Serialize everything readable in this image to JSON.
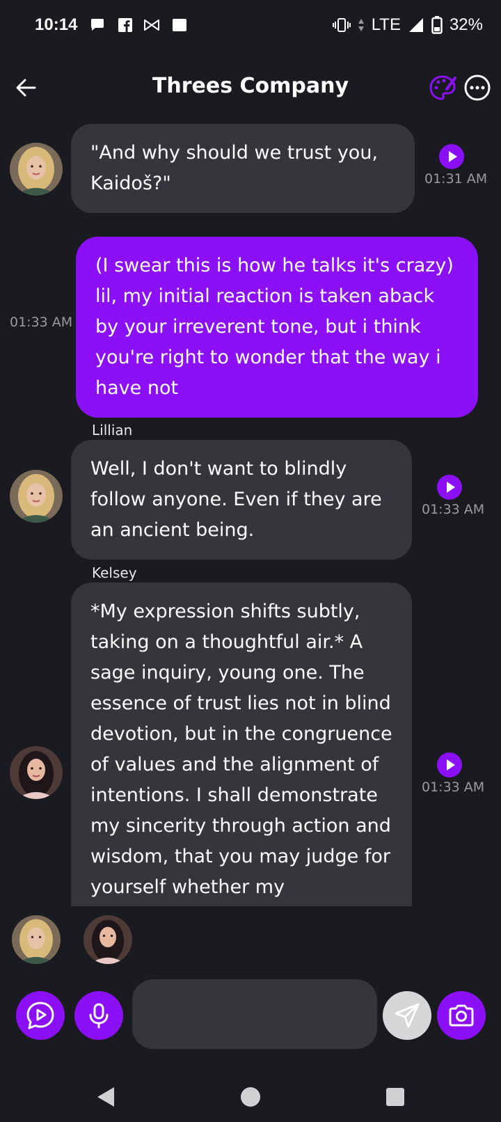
{
  "status": {
    "time": "10:14",
    "network": "LTE",
    "battery": "32%"
  },
  "header": {
    "title": "Threes Company"
  },
  "messages": [
    {
      "sender": "",
      "text": "\"And why should we trust you, Kaidoš?\"",
      "time": "01:31 AM"
    },
    {
      "sender": "",
      "text": "(I swear this is how he talks it's crazy) lil, my initial reaction is taken aback by your irreverent tone, but i think you're right to wonder that the way i have not",
      "time": "01:33 AM"
    },
    {
      "sender": "Lillian",
      "text": "Well, I don't want to blindly follow anyone. Even if they are an ancient being.",
      "time": "01:33 AM"
    },
    {
      "sender": "Kelsey",
      "text": "*My expression shifts subtly, taking on a thoughtful air.* A sage inquiry, young one. The essence of trust lies not in blind devotion, but in the congruence of values and the alignment of intentions. I shall demonstrate my sincerity through action and wisdom, that you may judge for yourself whether my",
      "time": "01:33 AM"
    }
  ],
  "input": {
    "placeholder": ""
  },
  "colors": {
    "accent": "#8b10f5",
    "background": "#1a1b20",
    "bubble": "#35363c"
  },
  "icons": {
    "back": "arrow-left-icon",
    "palette": "palette-icon",
    "more": "more-icon",
    "play": "play-icon",
    "voice": "voice-chat-icon",
    "mic": "microphone-icon",
    "send": "send-icon",
    "camera": "camera-icon"
  }
}
